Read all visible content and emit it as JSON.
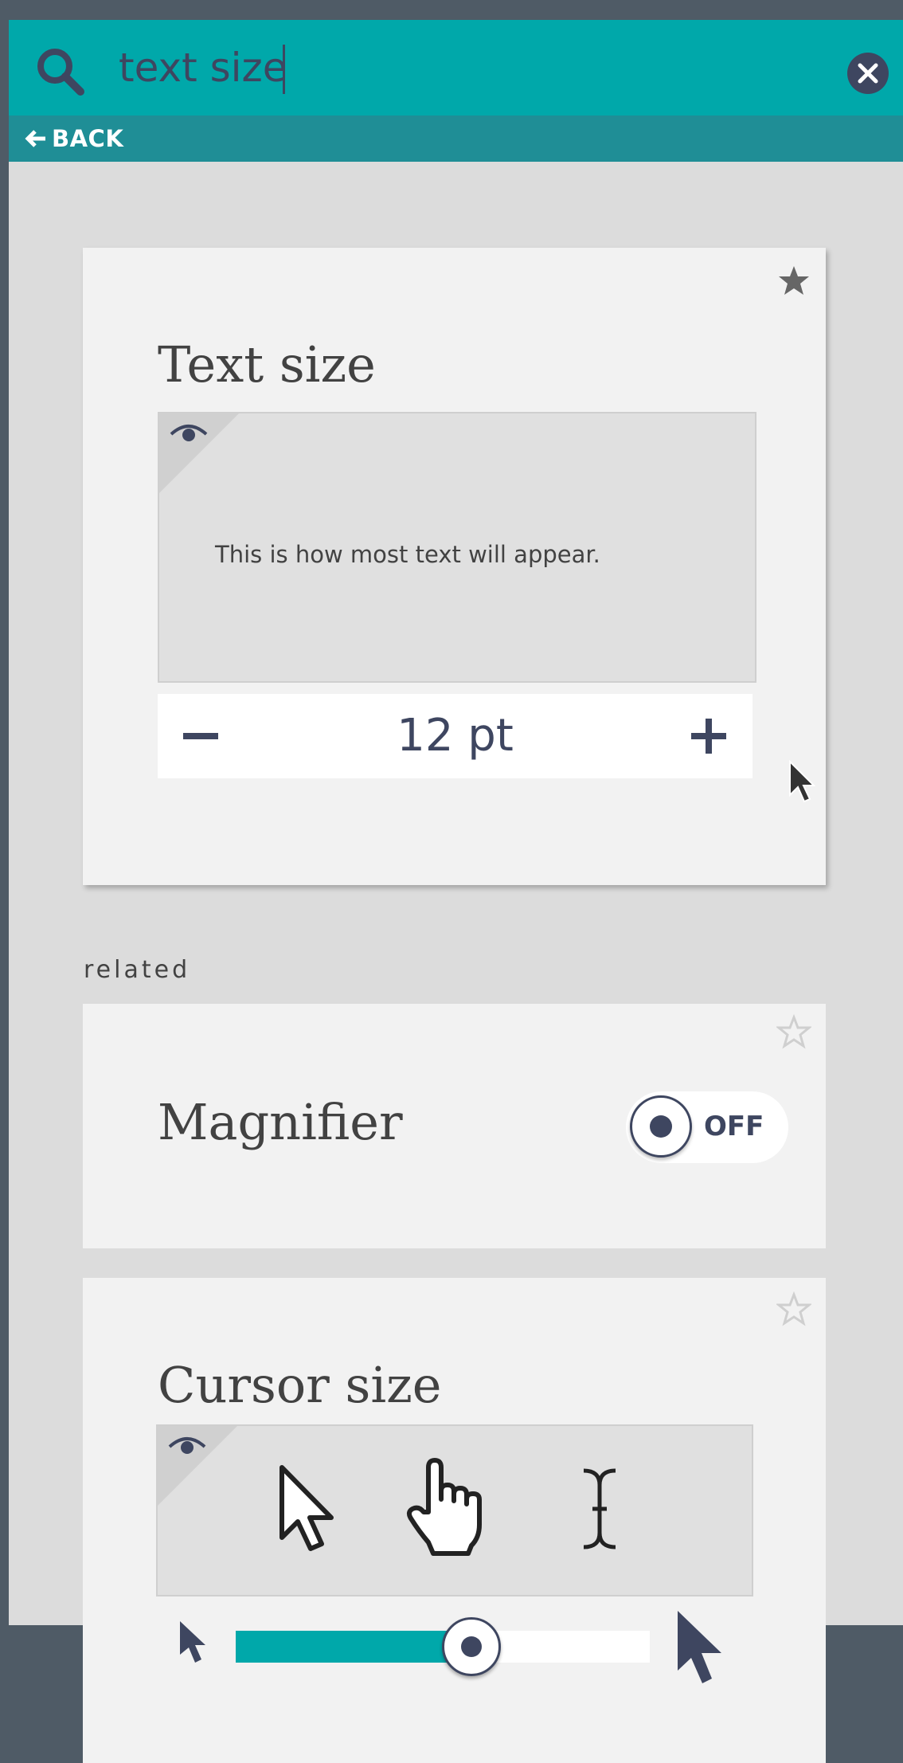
{
  "search": {
    "query": "text size"
  },
  "nav": {
    "back_label": "BACK"
  },
  "main_setting": {
    "title": "Text size",
    "preview_text": "This is how most text will appear.",
    "value_label": "12 pt"
  },
  "related": {
    "heading": "related",
    "items": [
      {
        "title": "Magnifier",
        "toggle_label": "OFF",
        "toggle_on": false
      },
      {
        "title": "Cursor size",
        "slider_level": 0.57
      }
    ]
  },
  "icons": {
    "search": "search-icon",
    "clear": "close-icon",
    "back": "arrow-left-icon",
    "favorite_filled": "star-filled-icon",
    "favorite_outline": "star-outline-icon",
    "preview": "eye-icon",
    "decrease": "minus-icon",
    "increase": "plus-icon",
    "cursors": [
      "arrow-cursor-icon",
      "hand-cursor-icon",
      "text-cursor-icon"
    ]
  },
  "colors": {
    "accent": "#00a8aa",
    "accent_dark": "#1f8e96",
    "ink": "#3e4660",
    "panel": "#dcdcdc",
    "card": "#f2f2f2"
  }
}
